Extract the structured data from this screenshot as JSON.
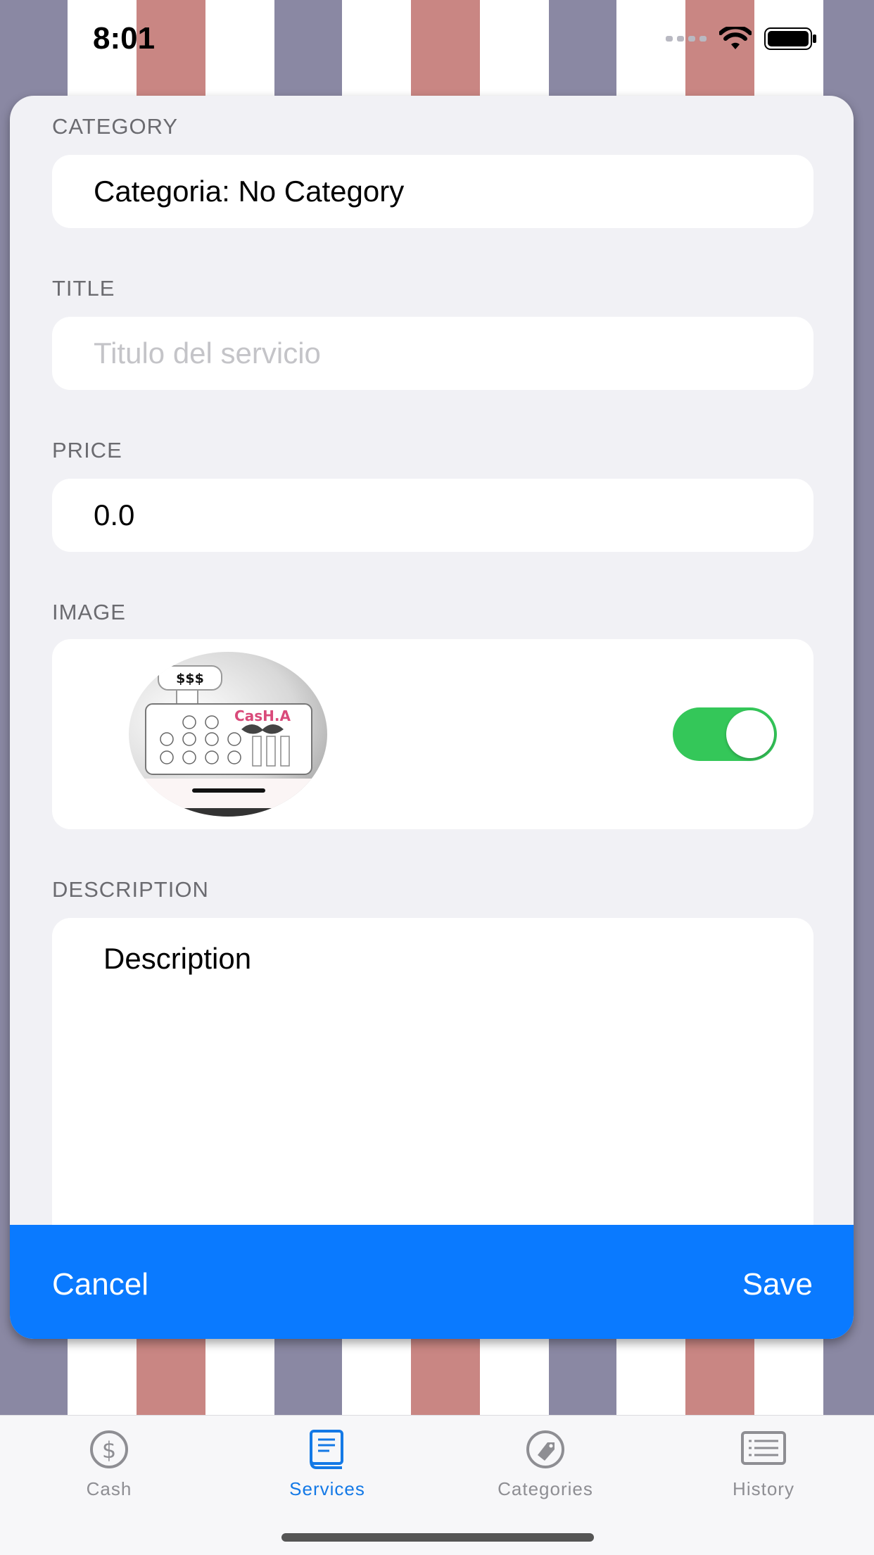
{
  "status_bar": {
    "time": "8:01"
  },
  "form": {
    "category": {
      "label": "CATEGORY",
      "value": "Categoria: No Category"
    },
    "title": {
      "label": "TITLE",
      "value": "",
      "placeholder": "Titulo del servicio"
    },
    "price": {
      "label": "PRICE",
      "value": "0.0"
    },
    "image": {
      "label": "IMAGE",
      "toggle_on": true,
      "thumb_text": "$$$",
      "logo_text": "CasH.A"
    },
    "description": {
      "label": "DESCRIPTION",
      "value": "Description"
    }
  },
  "actions": {
    "cancel_label": "Cancel",
    "save_label": "Save"
  },
  "tabbar": {
    "active_color": "#1479e6",
    "inactive_color": "#8e8e93",
    "items": [
      {
        "label": "Cash",
        "icon": "dollar-circle-icon",
        "active": false
      },
      {
        "label": "Services",
        "icon": "book-icon",
        "active": true
      },
      {
        "label": "Categories",
        "icon": "tag-icon",
        "active": false
      },
      {
        "label": "History",
        "icon": "list-icon",
        "active": false
      }
    ]
  },
  "colors": {
    "accent": "#0a7aff",
    "toggle": "#34c759"
  }
}
